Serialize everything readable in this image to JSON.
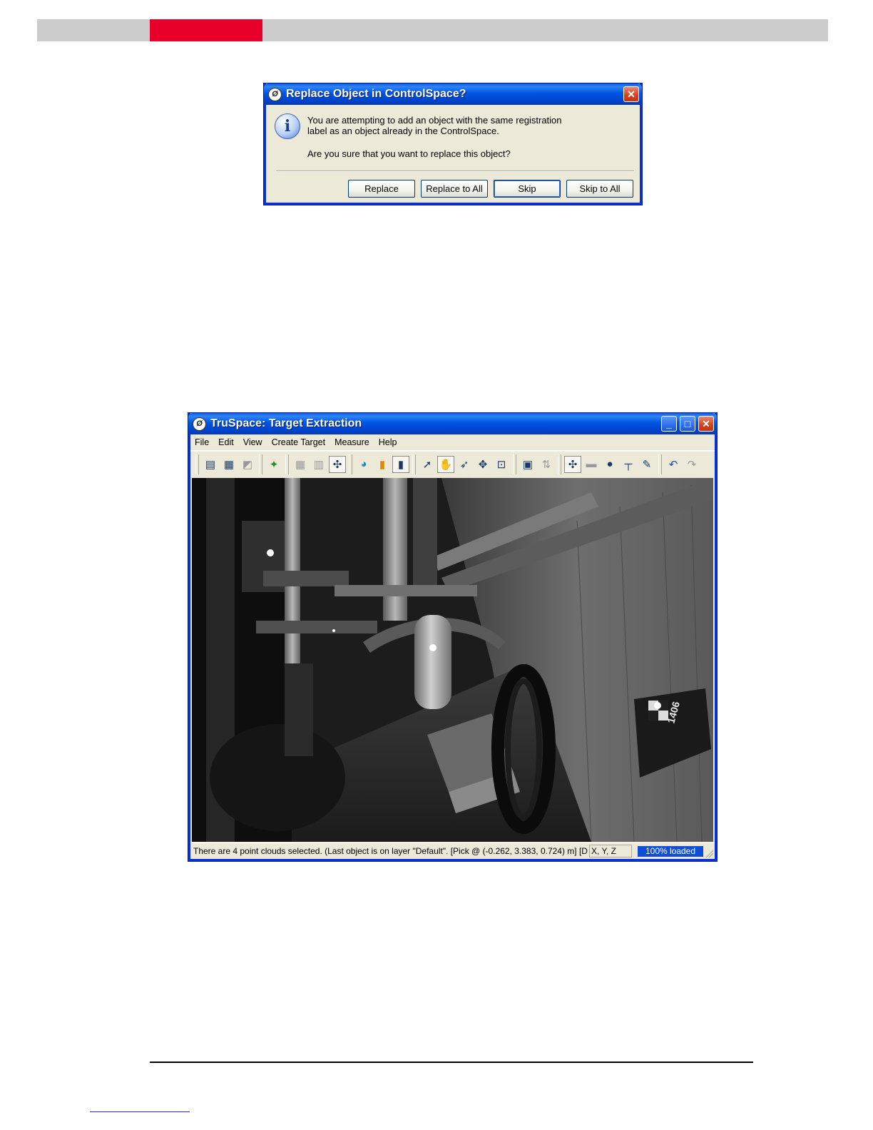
{
  "dialog": {
    "title": "Replace Object in ControlSpace?",
    "message_line1": "You are attempting to add an object with the same registration",
    "message_line2": "label as an object already in the ControlSpace.",
    "question": "Are you sure that you want to replace this object?",
    "buttons": {
      "replace": "Replace",
      "replace_all": "Replace to All",
      "skip": "Skip",
      "skip_all": "Skip  to All"
    },
    "close_glyph": "✕"
  },
  "app": {
    "title": "TruSpace: Target Extraction",
    "menu": [
      "File",
      "Edit",
      "View",
      "Create Target",
      "Measure",
      "Help"
    ],
    "window_controls": {
      "minimize": "_",
      "maximize": "□",
      "close": "✕"
    },
    "toolbar_icons": [
      "open-scan-icon",
      "save-scan-icon",
      "export-icon",
      "satellite-icon",
      "grid-icon",
      "grid-alt-icon",
      "pick-targets-icon",
      "color-mode-icon",
      "intensity-mode-icon",
      "grayscale-mode-icon",
      "select-icon",
      "pan-icon",
      "pick-icon",
      "orbit-icon",
      "zoom-icon",
      "report-icon",
      "swap-icon",
      "target-add-icon",
      "target-plane-icon",
      "target-sphere-icon",
      "target-measure-icon",
      "target-edit-icon",
      "undo-icon",
      "redo-icon"
    ],
    "status": {
      "text": "There are 4 point clouds selected. (Last object is on layer \"Default\". [Pick @ (-0.262, 3.383, 0.724) m] [D",
      "coords": "X, Y, Z",
      "loaded": "100% loaded"
    },
    "scene_label": "1406"
  }
}
